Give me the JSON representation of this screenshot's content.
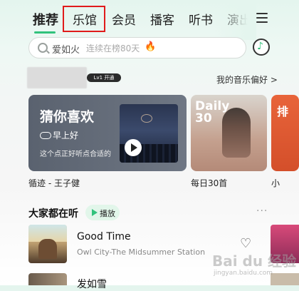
{
  "nav": {
    "tabs": [
      "推荐",
      "乐馆",
      "会员",
      "播客",
      "听书",
      "演出"
    ],
    "active_index": 0,
    "highlighted_index": 1
  },
  "search": {
    "query": "爱如火",
    "trend_text": "连续在榜80天",
    "fire_icon": "🔥"
  },
  "profile": {
    "level_badge": "Lv1 开通",
    "preference_link": "我的音乐偏好 >"
  },
  "cards": {
    "main": {
      "title": "猜你喜欢",
      "greeting": "早上好",
      "description": "这个点正好听点合适的",
      "caption": "循迹 - 王子健"
    },
    "daily": {
      "badge": "Daily 30",
      "caption": "每日30首"
    },
    "peek": {
      "badge": "排",
      "caption": "小"
    }
  },
  "section": {
    "title": "大家都在听",
    "play_label": "播放",
    "more": "···"
  },
  "songs": [
    {
      "title": "Good Time",
      "artist": "Owl City-The Midsummer Station"
    },
    {
      "title": "发如雪",
      "artist": ""
    }
  ],
  "watermark": {
    "text": "Bai du 经验",
    "url_text": "jingyan.baidu.com"
  },
  "colors": {
    "accent": "#31c27c",
    "highlight_box": "#e01b1b"
  }
}
